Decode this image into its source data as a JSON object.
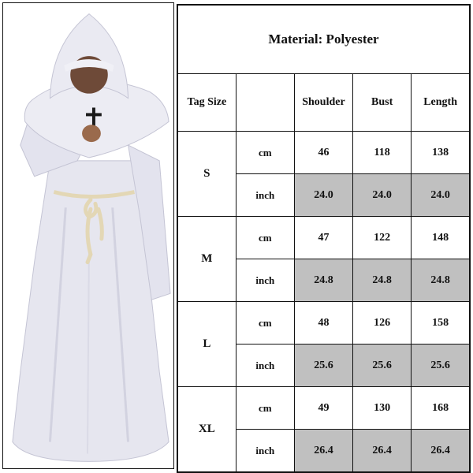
{
  "product": {
    "image_alt": "Person wearing a white hooded monk robe with a cross necklace and a rope belt",
    "colors": {
      "robe": "#e9e9f1",
      "robe_shadow": "#c9c9d8",
      "rope": "#e3d7b5",
      "cross": "#1a1a1a",
      "skin": "#8a5a40",
      "shaded_cell": "#c0c0c0"
    }
  },
  "table": {
    "title": "Material: Polyester",
    "headers": {
      "tag_size": "Tag Size",
      "unit": "",
      "shoulder": "Shoulder",
      "bust": "Bust",
      "length": "Length"
    },
    "sizes": [
      {
        "size": "S",
        "cm": {
          "unit": "cm",
          "shoulder": "46",
          "bust": "118",
          "length": "138"
        },
        "inch": {
          "unit": "inch",
          "shoulder": "24.0",
          "bust": "24.0",
          "length": "24.0"
        }
      },
      {
        "size": "M",
        "cm": {
          "unit": "cm",
          "shoulder": "47",
          "bust": "122",
          "length": "148"
        },
        "inch": {
          "unit": "inch",
          "shoulder": "24.8",
          "bust": "24.8",
          "length": "24.8"
        }
      },
      {
        "size": "L",
        "cm": {
          "unit": "cm",
          "shoulder": "48",
          "bust": "126",
          "length": "158"
        },
        "inch": {
          "unit": "inch",
          "shoulder": "25.6",
          "bust": "25.6",
          "length": "25.6"
        }
      },
      {
        "size": "XL",
        "cm": {
          "unit": "cm",
          "shoulder": "49",
          "bust": "130",
          "length": "168"
        },
        "inch": {
          "unit": "inch",
          "shoulder": "26.4",
          "bust": "26.4",
          "length": "26.4"
        }
      }
    ]
  }
}
